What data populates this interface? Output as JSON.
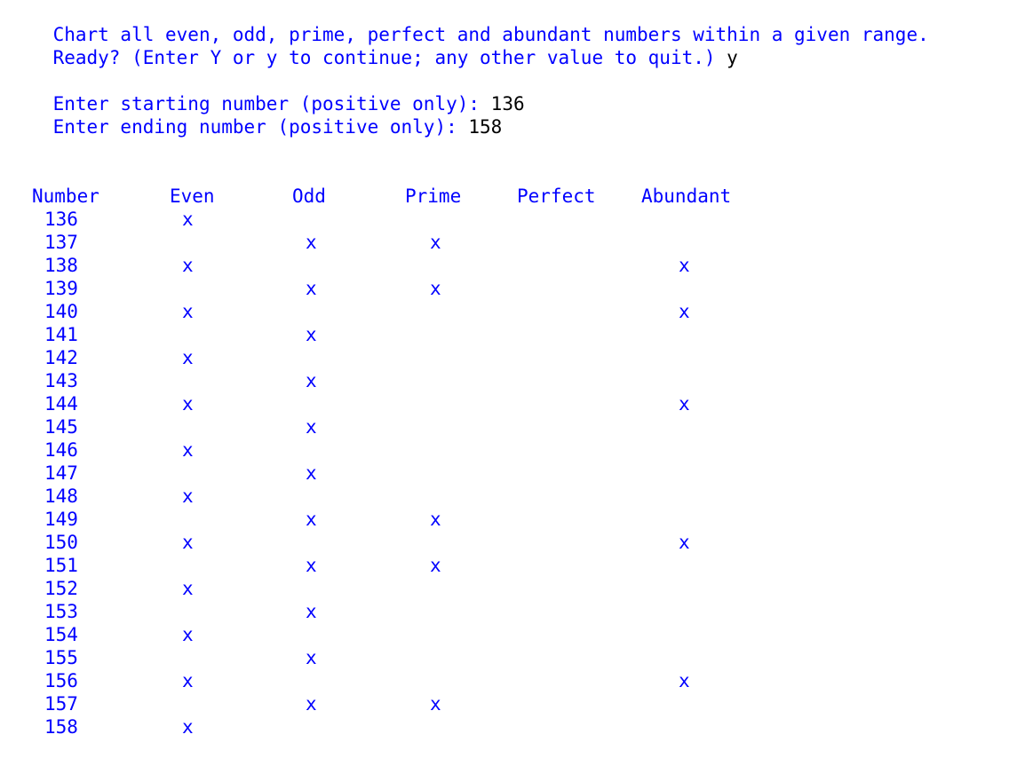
{
  "terminal": {
    "intro_line": "Chart all even, odd, prime, perfect and abundant numbers within a given range.",
    "ready_prompt": "Ready? (Enter Y or y to continue; any other value to quit.) ",
    "ready_input": "y",
    "start_prompt": "Enter starting number (positive only): ",
    "start_input": "136",
    "end_prompt": "Enter ending number (positive only): ",
    "end_input": "158"
  },
  "table": {
    "headers": {
      "number": "Number",
      "even": "Even",
      "odd": "Odd",
      "prime": "Prime",
      "perfect": "Perfect",
      "abundant": "Abundant"
    },
    "mark": "x",
    "rows": [
      {
        "number": "136",
        "even": true,
        "odd": false,
        "prime": false,
        "perfect": false,
        "abundant": false
      },
      {
        "number": "137",
        "even": false,
        "odd": true,
        "prime": true,
        "perfect": false,
        "abundant": false
      },
      {
        "number": "138",
        "even": true,
        "odd": false,
        "prime": false,
        "perfect": false,
        "abundant": true
      },
      {
        "number": "139",
        "even": false,
        "odd": true,
        "prime": true,
        "perfect": false,
        "abundant": false
      },
      {
        "number": "140",
        "even": true,
        "odd": false,
        "prime": false,
        "perfect": false,
        "abundant": true
      },
      {
        "number": "141",
        "even": false,
        "odd": true,
        "prime": false,
        "perfect": false,
        "abundant": false
      },
      {
        "number": "142",
        "even": true,
        "odd": false,
        "prime": false,
        "perfect": false,
        "abundant": false
      },
      {
        "number": "143",
        "even": false,
        "odd": true,
        "prime": false,
        "perfect": false,
        "abundant": false
      },
      {
        "number": "144",
        "even": true,
        "odd": false,
        "prime": false,
        "perfect": false,
        "abundant": true
      },
      {
        "number": "145",
        "even": false,
        "odd": true,
        "prime": false,
        "perfect": false,
        "abundant": false
      },
      {
        "number": "146",
        "even": true,
        "odd": false,
        "prime": false,
        "perfect": false,
        "abundant": false
      },
      {
        "number": "147",
        "even": false,
        "odd": true,
        "prime": false,
        "perfect": false,
        "abundant": false
      },
      {
        "number": "148",
        "even": true,
        "odd": false,
        "prime": false,
        "perfect": false,
        "abundant": false
      },
      {
        "number": "149",
        "even": false,
        "odd": true,
        "prime": true,
        "perfect": false,
        "abundant": false
      },
      {
        "number": "150",
        "even": true,
        "odd": false,
        "prime": false,
        "perfect": false,
        "abundant": true
      },
      {
        "number": "151",
        "even": false,
        "odd": true,
        "prime": true,
        "perfect": false,
        "abundant": false
      },
      {
        "number": "152",
        "even": true,
        "odd": false,
        "prime": false,
        "perfect": false,
        "abundant": false
      },
      {
        "number": "153",
        "even": false,
        "odd": true,
        "prime": false,
        "perfect": false,
        "abundant": false
      },
      {
        "number": "154",
        "even": true,
        "odd": false,
        "prime": false,
        "perfect": false,
        "abundant": false
      },
      {
        "number": "155",
        "even": false,
        "odd": true,
        "prime": false,
        "perfect": false,
        "abundant": false
      },
      {
        "number": "156",
        "even": true,
        "odd": false,
        "prime": false,
        "perfect": false,
        "abundant": true
      },
      {
        "number": "157",
        "even": false,
        "odd": true,
        "prime": true,
        "perfect": false,
        "abundant": false
      },
      {
        "number": "158",
        "even": true,
        "odd": false,
        "prime": false,
        "perfect": false,
        "abundant": false
      }
    ]
  }
}
